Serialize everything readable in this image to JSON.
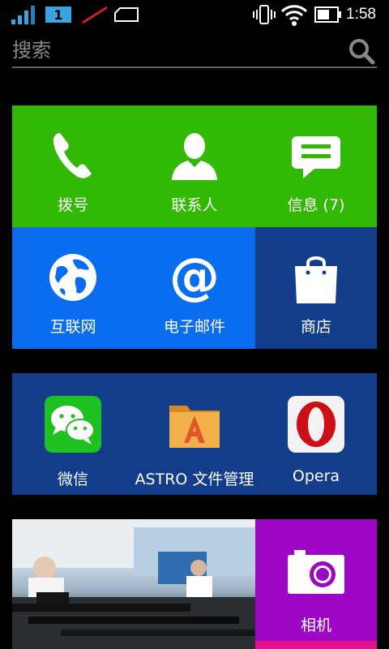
{
  "status_bar": {
    "sim_slot": "1",
    "time": "1:58"
  },
  "search": {
    "placeholder": "搜索"
  },
  "tiles": [
    {
      "label": "拨号",
      "icon": "phone-icon",
      "color": "#31b906"
    },
    {
      "label": "联系人",
      "icon": "contact-person-icon",
      "color": "#31b906"
    },
    {
      "label": "信息 (7)",
      "icon": "message-bubble-icon",
      "color": "#31b906"
    },
    {
      "label": "互联网",
      "icon": "globe-icon",
      "color": "#0a6df0"
    },
    {
      "label": "电子邮件",
      "icon": "at-sign-icon",
      "color": "#0a6df0"
    },
    {
      "label": "商店",
      "icon": "shopping-bag-icon",
      "color": "#133c8a"
    },
    {
      "label": "微信",
      "icon": "wechat-icon",
      "color": "#133c8a"
    },
    {
      "label": "ASTRO 文件管理",
      "icon": "astro-folder-icon",
      "color": "#133c8a"
    },
    {
      "label": "Opera",
      "icon": "opera-icon",
      "color": "#133c8a"
    },
    {
      "label": "相机",
      "icon": "camera-icon",
      "color": "#9d06c3"
    }
  ]
}
